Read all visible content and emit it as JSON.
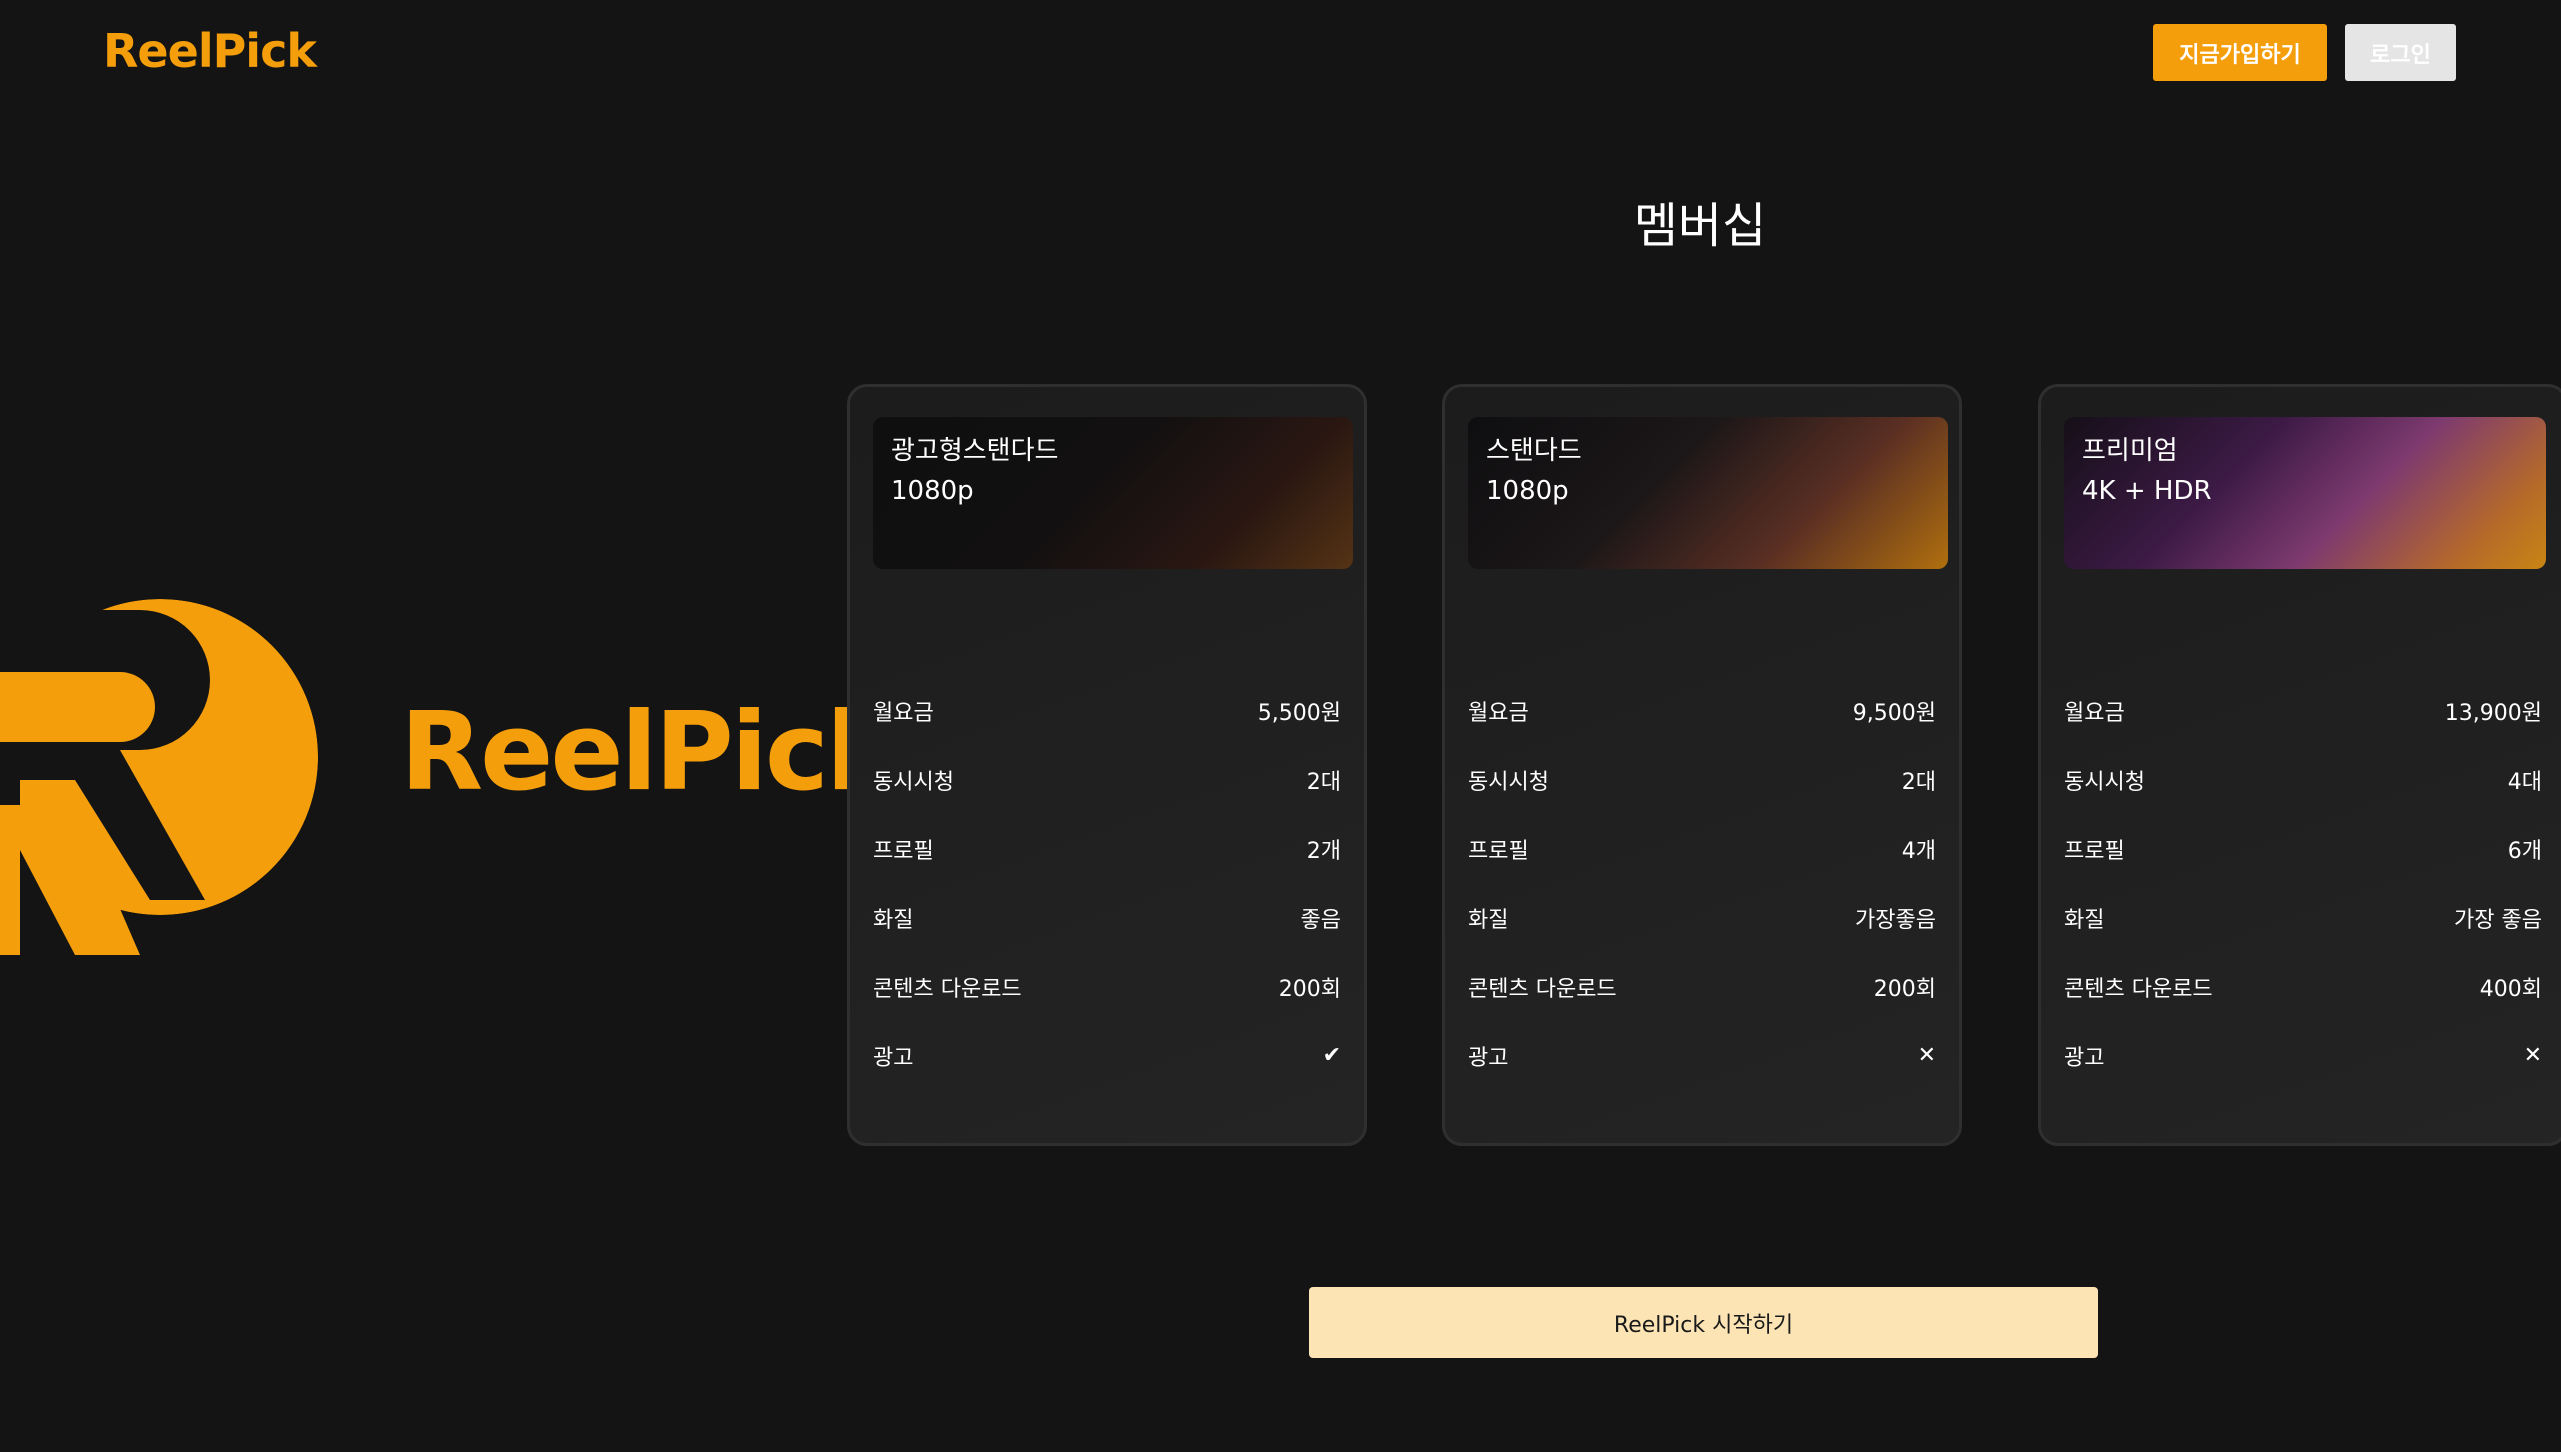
{
  "header": {
    "logo_text": "ReelPick",
    "signup_label": "지금가입하기",
    "login_label": "로그인"
  },
  "hero": {
    "brand_text": "ReelPick"
  },
  "page": {
    "title": "멤버십"
  },
  "plans": [
    {
      "name": "광고형스탠다드",
      "resolution": "1080p",
      "rows": [
        {
          "label": "월요금",
          "value": "5,500원"
        },
        {
          "label": "동시시청",
          "value": "2대"
        },
        {
          "label": "프로필",
          "value": "2개"
        },
        {
          "label": "화질",
          "value": "좋음"
        },
        {
          "label": "콘텐츠 다운로드",
          "value": "200회"
        },
        {
          "label": "광고",
          "value": "✔"
        }
      ]
    },
    {
      "name": "스탠다드",
      "resolution": "1080p",
      "rows": [
        {
          "label": "월요금",
          "value": "9,500원"
        },
        {
          "label": "동시시청",
          "value": "2대"
        },
        {
          "label": "프로필",
          "value": "4개"
        },
        {
          "label": "화질",
          "value": "가장좋음"
        },
        {
          "label": "콘텐츠 다운로드",
          "value": "200회"
        },
        {
          "label": "광고",
          "value": "✕"
        }
      ]
    },
    {
      "name": "프리미엄",
      "resolution": "4K + HDR",
      "rows": [
        {
          "label": "월요금",
          "value": "13,900원"
        },
        {
          "label": "동시시청",
          "value": "4대"
        },
        {
          "label": "프로필",
          "value": "6개"
        },
        {
          "label": "화질",
          "value": "가장 좋음"
        },
        {
          "label": "콘텐츠 다운로드",
          "value": "400회"
        },
        {
          "label": "광고",
          "value": "✕"
        }
      ]
    }
  ],
  "cta": {
    "label": "ReelPick 시작하기"
  },
  "colors": {
    "accent": "#f59e0b",
    "background": "#141414",
    "cta_background": "#fde4b4"
  }
}
